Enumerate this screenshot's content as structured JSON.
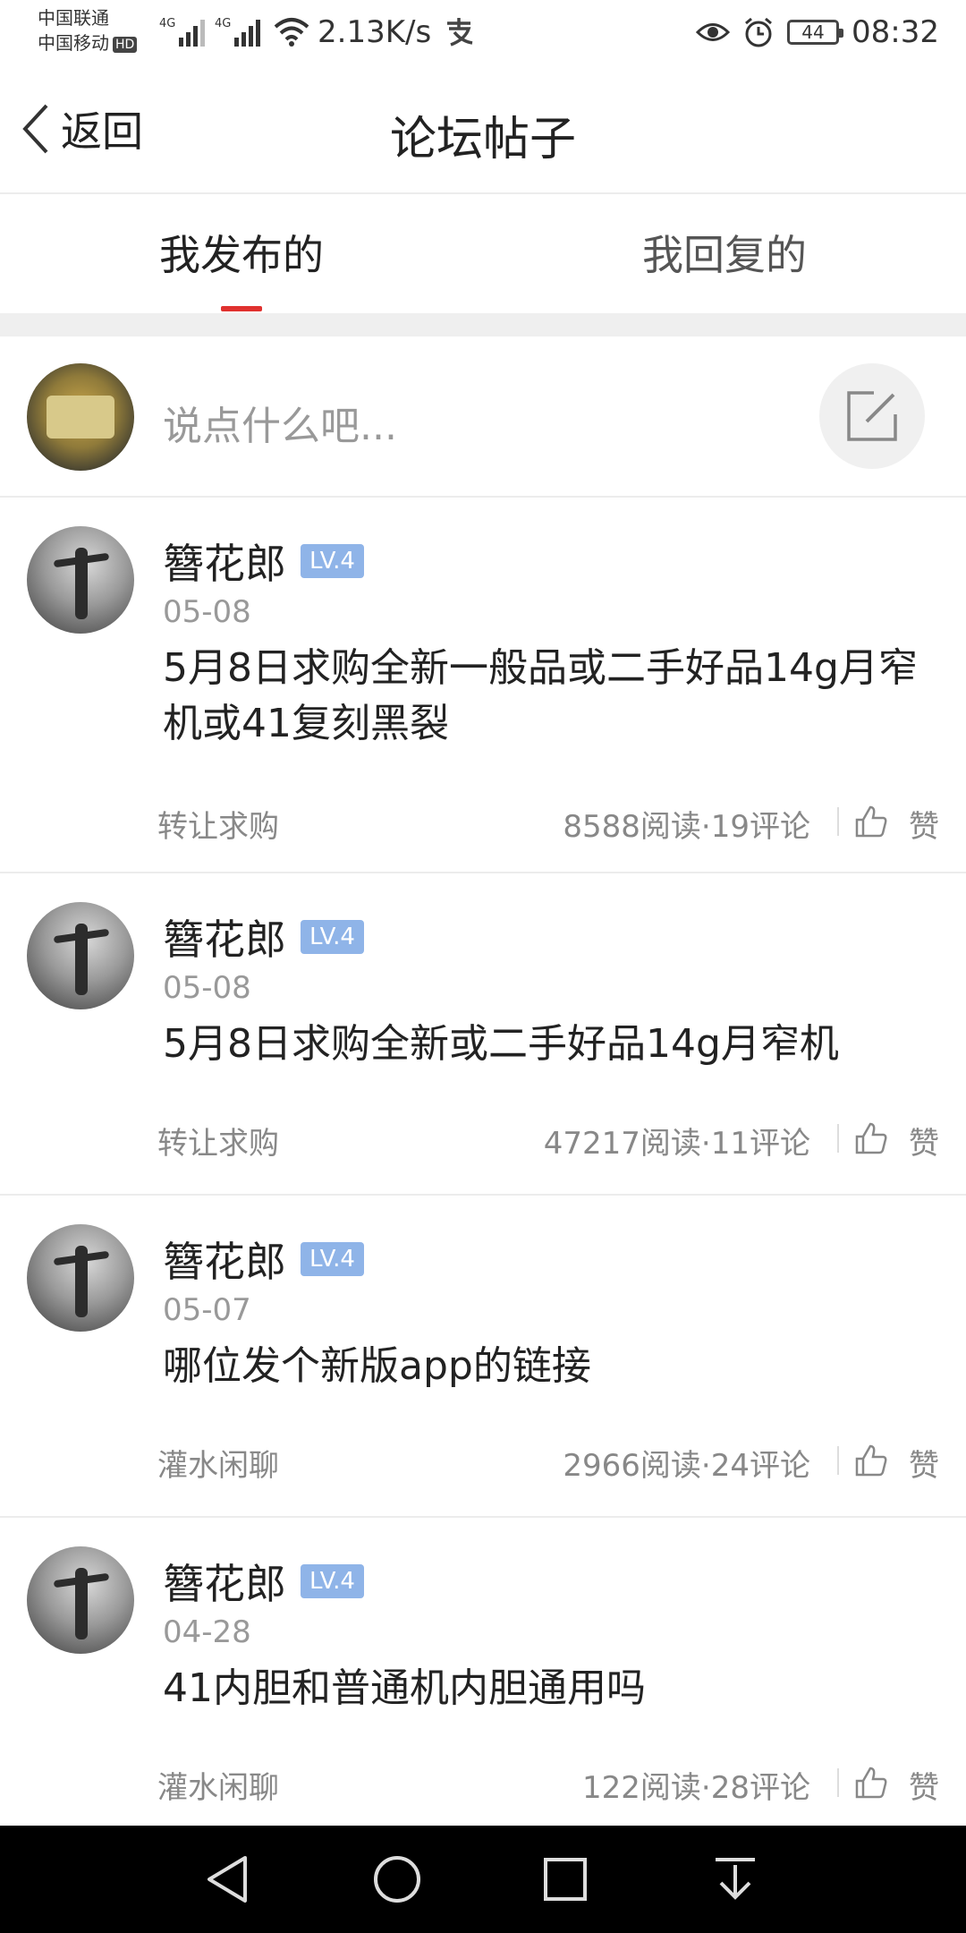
{
  "status_bar": {
    "carrier_1": "中国联通",
    "carrier_2": "中国移动",
    "hd": "HD",
    "network_1": "4G",
    "network_2": "4G",
    "speed": "2.13K/s",
    "battery": "44",
    "time": "08:32"
  },
  "header": {
    "back_label": "返回",
    "title": "论坛帖子"
  },
  "tabs": [
    {
      "label": "我发布的",
      "active": true
    },
    {
      "label": "我回复的",
      "active": false
    }
  ],
  "composer": {
    "placeholder": "说点什么吧..."
  },
  "posts": [
    {
      "author": "簪花郎",
      "level": "LV.4",
      "date": "05-08",
      "title": "5月8日求购全新一般品或二手好品14g月窄机或41复刻黑裂",
      "category": "转让求购",
      "stats": "8588阅读·19评论",
      "like_label": "赞"
    },
    {
      "author": "簪花郎",
      "level": "LV.4",
      "date": "05-08",
      "title": "5月8日求购全新或二手好品14g月窄机",
      "category": "转让求购",
      "stats": "47217阅读·11评论",
      "like_label": "赞"
    },
    {
      "author": "簪花郎",
      "level": "LV.4",
      "date": "05-07",
      "title": "哪位发个新版app的链接",
      "category": "灌水闲聊",
      "stats": "2966阅读·24评论",
      "like_label": "赞"
    },
    {
      "author": "簪花郎",
      "level": "LV.4",
      "date": "04-28",
      "title": "41内胆和普通机内胆通用吗",
      "category": "灌水闲聊",
      "stats": "122阅读·28评论",
      "like_label": "赞"
    }
  ],
  "colors": {
    "accent": "#e0312f",
    "level_badge": "#8fb4e8"
  },
  "icons": [
    "back-chevron-icon",
    "compose-edit-icon",
    "thumbs-up-icon",
    "nav-back-icon",
    "nav-home-icon",
    "nav-recents-icon",
    "nav-notification-icon"
  ]
}
